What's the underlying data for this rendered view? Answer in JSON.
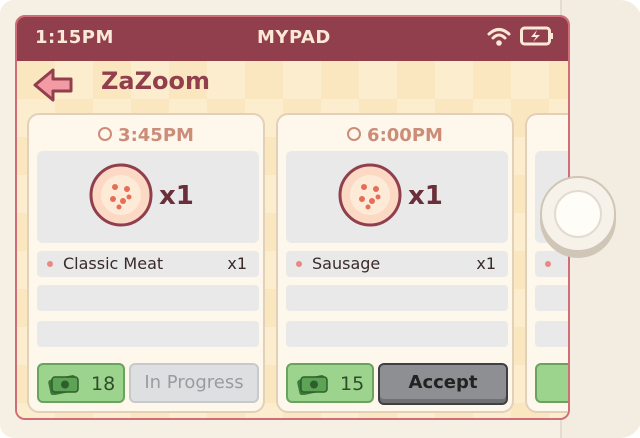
{
  "status_bar": {
    "time": "1:15PM",
    "device_name": "MYPAD",
    "wifi_icon": "wifi-icon",
    "battery_icon": "battery-charging-icon"
  },
  "app": {
    "title": "ZaZoom",
    "back_icon": "back-arrow-icon"
  },
  "orders": [
    {
      "time": "3:45PM",
      "pizza_count": "x1",
      "items": [
        {
          "name": "Classic Meat",
          "qty": "x1"
        }
      ],
      "payout": "18",
      "action_label": "In Progress",
      "action_state": "disabled"
    },
    {
      "time": "6:00PM",
      "pizza_count": "x1",
      "items": [
        {
          "name": "Sausage",
          "qty": "x1"
        }
      ],
      "payout": "15",
      "action_label": "Accept",
      "action_state": "enabled"
    }
  ],
  "colors": {
    "status_bar": "#913f4d",
    "accent": "#913f4d",
    "price_button": "#9cd48e",
    "accept_button": "#8e8f92"
  }
}
